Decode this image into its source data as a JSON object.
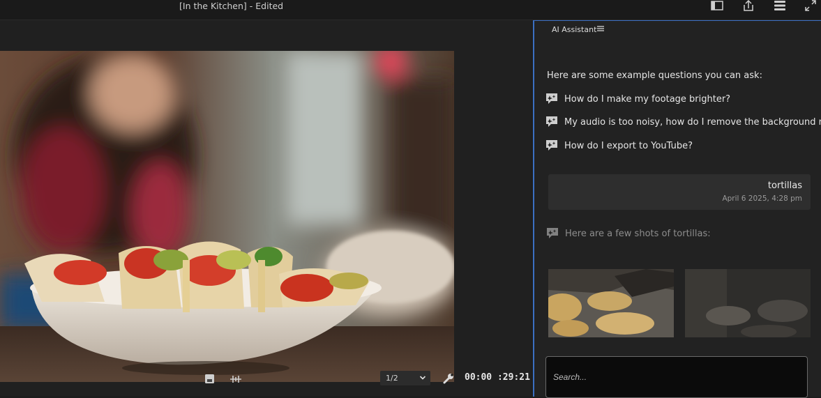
{
  "window": {
    "title": "[In the Kitchen] - Edited",
    "icons": [
      "panel-layout-icon",
      "share-export-icon",
      "stack-menu-icon",
      "fullscreen-icon"
    ]
  },
  "monitor": {
    "resolution": "1/2",
    "timecode": "00:00 :29:21",
    "controls": [
      "export-frame-icon",
      "insert-edit-icon",
      "settings-wrench-icon"
    ]
  },
  "assistant": {
    "header": "AI Assistant",
    "intro": "Here are some example questions you can ask:",
    "examples": [
      "How do I make my footage brighter?",
      "My audio is too noisy, how do I remove the background noise?",
      "How do I export to YouTube?"
    ],
    "user_message": {
      "text": "tortillas",
      "timestamp": "April 6 2025, 4:28 pm"
    },
    "response": "Here are a few shots of tortillas:",
    "search_placeholder": "Search..."
  },
  "colors": {
    "accent": "#3b6fc2",
    "panel_bg": "#222222",
    "app_bg": "#1d1d1d"
  }
}
